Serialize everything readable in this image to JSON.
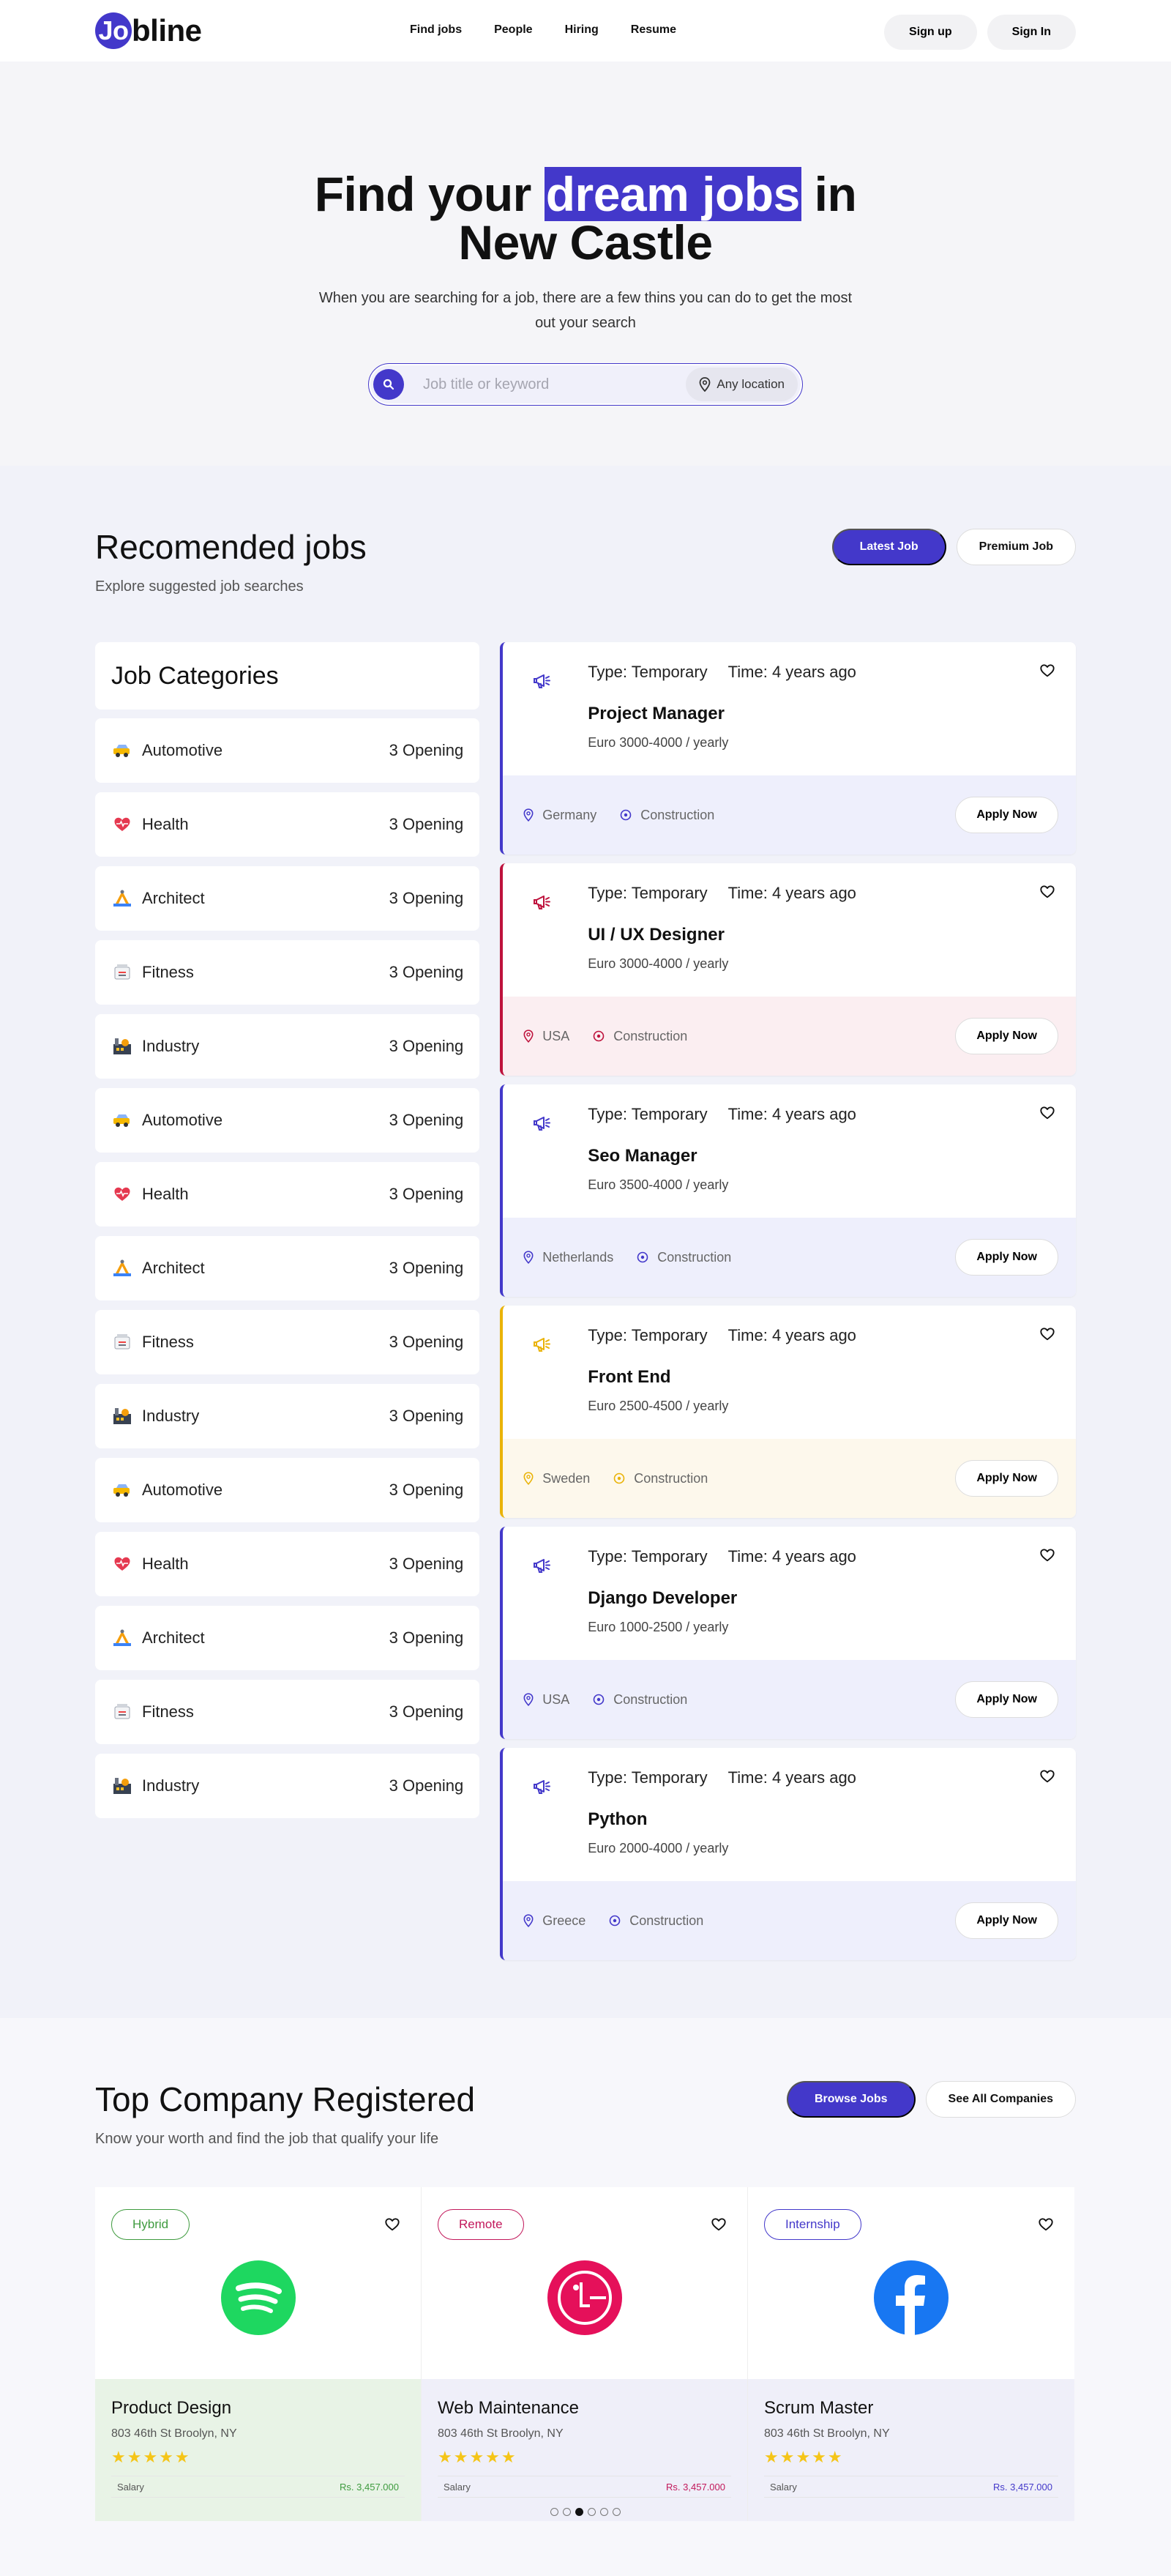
{
  "nav": {
    "logo_letter": "Jo",
    "logo_rest": "bline",
    "links": [
      "Find jobs",
      "People",
      "Hiring",
      "Resume"
    ],
    "signup": "Sign up",
    "signin": "Sign In"
  },
  "hero": {
    "title_pre": "Find your ",
    "title_hl": "dream jobs",
    "title_post": " in",
    "title_line2": "New Castle",
    "subtitle": "When you are searching for a job, there are a few thins you can do to get the most out your search",
    "search_placeholder": "Job title or keyword",
    "location": "Any location"
  },
  "recommended": {
    "title": "Recomended jobs",
    "subtitle": "Explore suggested job searches",
    "btn_latest": "Latest Job",
    "btn_premium": "Premium Job",
    "categories_title": "Job Categories",
    "categories": [
      {
        "name": "Automotive",
        "count": "3 Opening",
        "icon": "car-icon"
      },
      {
        "name": "Health",
        "count": "3 Opening",
        "icon": "heart-pulse-icon"
      },
      {
        "name": "Architect",
        "count": "3 Opening",
        "icon": "architect-icon"
      },
      {
        "name": "Fitness",
        "count": "3 Opening",
        "icon": "fitness-icon"
      },
      {
        "name": "Industry",
        "count": "3 Opening",
        "icon": "industry-icon"
      },
      {
        "name": "Automotive",
        "count": "3 Opening",
        "icon": "car-icon"
      },
      {
        "name": "Health",
        "count": "3 Opening",
        "icon": "heart-pulse-icon"
      },
      {
        "name": "Architect",
        "count": "3 Opening",
        "icon": "architect-icon"
      },
      {
        "name": "Fitness",
        "count": "3 Opening",
        "icon": "fitness-icon"
      },
      {
        "name": "Industry",
        "count": "3 Opening",
        "icon": "industry-icon"
      },
      {
        "name": "Automotive",
        "count": "3 Opening",
        "icon": "car-icon"
      },
      {
        "name": "Health",
        "count": "3 Opening",
        "icon": "heart-pulse-icon"
      },
      {
        "name": "Architect",
        "count": "3 Opening",
        "icon": "architect-icon"
      },
      {
        "name": "Fitness",
        "count": "3 Opening",
        "icon": "fitness-icon"
      },
      {
        "name": "Industry",
        "count": "3 Opening",
        "icon": "industry-icon"
      }
    ],
    "jobs": [
      {
        "type": "Type: Temporary",
        "time": "Time: 4 years ago",
        "title": "Project Manager",
        "salary": "Euro 3000-4000 / yearly",
        "country": "Germany",
        "sector": "Construction",
        "apply": "Apply Now",
        "accent": "#4338ca",
        "bg": "#eeeffc"
      },
      {
        "type": "Type: Temporary",
        "time": "Time: 4 years ago",
        "title": "UI / UX Designer",
        "salary": "Euro 3000-4000 / yearly",
        "country": "USA",
        "sector": "Construction",
        "apply": "Apply Now",
        "accent": "#be123c",
        "bg": "#fbeef1"
      },
      {
        "type": "Type: Temporary",
        "time": "Time: 4 years ago",
        "title": "Seo Manager",
        "salary": "Euro 3500-4000 / yearly",
        "country": "Netherlands",
        "sector": "Construction",
        "apply": "Apply Now",
        "accent": "#4338ca",
        "bg": "#eeeffc"
      },
      {
        "type": "Type: Temporary",
        "time": "Time: 4 years ago",
        "title": "Front End",
        "salary": "Euro 2500-4500 / yearly",
        "country": "Sweden",
        "sector": "Construction",
        "apply": "Apply Now",
        "accent": "#eab308",
        "bg": "#fdf8ec"
      },
      {
        "type": "Type: Temporary",
        "time": "Time: 4 years ago",
        "title": "Django Developer",
        "salary": "Euro 1000-2500 / yearly",
        "country": "USA",
        "sector": "Construction",
        "apply": "Apply Now",
        "accent": "#4338ca",
        "bg": "#eeeffc"
      },
      {
        "type": "Type: Temporary",
        "time": "Time: 4 years ago",
        "title": "Python",
        "salary": "Euro 2000-4000 / yearly",
        "country": "Greece",
        "sector": "Construction",
        "apply": "Apply Now",
        "accent": "#4338ca",
        "bg": "#eeeffc"
      }
    ]
  },
  "companies": {
    "title": "Top Company Registered",
    "subtitle": "Know your worth and find the job that qualify your life",
    "btn_browse": "Browse Jobs",
    "btn_all": "See All Companies",
    "items": [
      {
        "badge": "Hybrid",
        "badge_color": "#3f9b3f",
        "logo": "spotify-logo",
        "logo_color": "#1ed760",
        "title": "Product Design",
        "address": "803 46th St Broolyn, NY",
        "stars": "★★★★★",
        "salary_label": "Salary",
        "salary": "Rs. 3,457.000",
        "salary_color": "#3f9b3f",
        "foot_bg": "#e8f3e6"
      },
      {
        "badge": "Remote",
        "badge_color": "#c2185b",
        "logo": "lg-logo",
        "logo_color": "#e5105a",
        "title": "Web Maintenance",
        "address": "803 46th St Broolyn, NY",
        "stars": "★★★★★",
        "salary_label": "Salary",
        "salary": "Rs. 3,457.000",
        "salary_color": "#c2185b",
        "foot_bg": "#efeff9"
      },
      {
        "badge": "Internship",
        "badge_color": "#4338ca",
        "logo": "facebook-logo",
        "logo_color": "#1877f2",
        "title": "Scrum Master",
        "address": "803 46th St Broolyn, NY",
        "stars": "★★★★★",
        "salary_label": "Salary",
        "salary": "Rs. 3,457.000",
        "salary_color": "#4338ca",
        "foot_bg": "#efeff9"
      }
    ],
    "carousel_active": 3,
    "carousel_count": 6
  },
  "colors": {
    "brand": "#4338ca"
  }
}
